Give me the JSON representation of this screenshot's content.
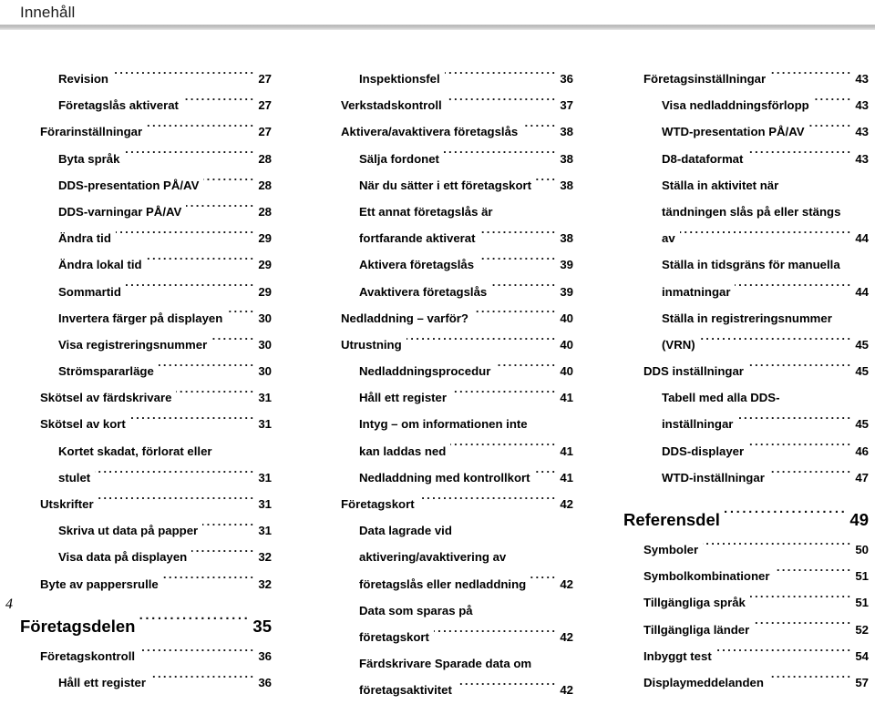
{
  "header": {
    "title": "Innehåll"
  },
  "footer": {
    "page_number": "4"
  },
  "columns": [
    {
      "name": "column-left",
      "entries": [
        {
          "level": 2,
          "label": "Revision",
          "page": "27"
        },
        {
          "level": 2,
          "label": "Företagslås aktiverat",
          "page": "27"
        },
        {
          "level": 1,
          "label": "Förarinställningar",
          "page": "27"
        },
        {
          "level": 2,
          "label": "Byta språk",
          "page": "28"
        },
        {
          "level": 2,
          "label": "DDS-presentation PÅ/AV",
          "page": "28"
        },
        {
          "level": 2,
          "label": "DDS-varningar PÅ/AV",
          "page": "28"
        },
        {
          "level": 2,
          "label": "Ändra tid",
          "page": "29"
        },
        {
          "level": 2,
          "label": "Ändra lokal tid",
          "page": "29"
        },
        {
          "level": 2,
          "label": "Sommartid",
          "page": "29"
        },
        {
          "level": 2,
          "label": "Invertera färger på displayen",
          "page": "30"
        },
        {
          "level": 2,
          "label": "Visa registreringsnummer",
          "page": "30"
        },
        {
          "level": 2,
          "label": "Strömspararläge",
          "page": "30"
        },
        {
          "level": 1,
          "label": "Skötsel av färdskrivare",
          "page": "31"
        },
        {
          "level": 1,
          "label": "Skötsel av kort",
          "page": "31"
        },
        {
          "level": 2,
          "label": "Kortet skadat, förlorat eller",
          "page": "",
          "wrap_top": true
        },
        {
          "level": 2,
          "label": "stulet",
          "page": "31"
        },
        {
          "level": 1,
          "label": "Utskrifter",
          "page": "31"
        },
        {
          "level": 2,
          "label": "Skriva ut data på papper",
          "page": "31"
        },
        {
          "level": 2,
          "label": "Visa data på displayen",
          "page": "32"
        },
        {
          "level": 1,
          "label": "Byte av pappersrulle",
          "page": "32"
        },
        {
          "level": 0,
          "label": "Företagsdelen",
          "page": "35",
          "gap_before": true
        },
        {
          "level": 1,
          "label": "Företagskontroll",
          "page": "36"
        },
        {
          "level": 2,
          "label": "Håll ett register",
          "page": "36"
        }
      ]
    },
    {
      "name": "column-middle",
      "entries": [
        {
          "level": 2,
          "label": "Inspektionsfel",
          "page": "36"
        },
        {
          "level": 1,
          "label": "Verkstadskontroll",
          "page": "37"
        },
        {
          "level": 1,
          "label": "Aktivera/avaktivera företagslås",
          "page": "38"
        },
        {
          "level": 2,
          "label": "Sälja fordonet",
          "page": "38"
        },
        {
          "level": 2,
          "label": "När du sätter i ett företagskort",
          "page": "38"
        },
        {
          "level": 2,
          "label": "Ett annat företagslås är",
          "page": "",
          "wrap_top": true
        },
        {
          "level": 2,
          "label": "fortfarande aktiverat",
          "page": "38"
        },
        {
          "level": 2,
          "label": "Aktivera företagslås",
          "page": "39"
        },
        {
          "level": 2,
          "label": "Avaktivera företagslås",
          "page": "39"
        },
        {
          "level": 1,
          "label": "Nedladdning – varför?",
          "page": "40"
        },
        {
          "level": 1,
          "label": "Utrustning",
          "page": "40"
        },
        {
          "level": 2,
          "label": "Nedladdningsprocedur",
          "page": "40"
        },
        {
          "level": 2,
          "label": "Håll ett register",
          "page": "41"
        },
        {
          "level": 2,
          "label": "Intyg – om informationen inte",
          "page": "",
          "wrap_top": true
        },
        {
          "level": 2,
          "label": "kan laddas ned",
          "page": "41"
        },
        {
          "level": 2,
          "label": "Nedladdning med kontrollkort",
          "page": "41"
        },
        {
          "level": 1,
          "label": "Företagskort",
          "page": "42"
        },
        {
          "level": 2,
          "label": "Data lagrade vid",
          "page": "",
          "wrap_top": true
        },
        {
          "level": 2,
          "label": "aktivering/avaktivering av",
          "page": "",
          "wrap_top": true
        },
        {
          "level": 2,
          "label": "företagslås eller nedladdning",
          "page": "42"
        },
        {
          "level": 2,
          "label": "Data som sparas på",
          "page": "",
          "wrap_top": true
        },
        {
          "level": 2,
          "label": "företagskort",
          "page": "42"
        },
        {
          "level": 2,
          "label": "Färdskrivare Sparade data om",
          "page": "",
          "wrap_top": true
        },
        {
          "level": 2,
          "label": "företagsaktivitet",
          "page": "42"
        }
      ]
    },
    {
      "name": "column-right",
      "entries": [
        {
          "level": 1,
          "label": "Företagsinställningar",
          "page": "43"
        },
        {
          "level": 2,
          "label": "Visa nedladdningsförlopp",
          "page": "43"
        },
        {
          "level": 2,
          "label": "WTD-presentation PÅ/AV",
          "page": "43"
        },
        {
          "level": 2,
          "label": "D8-dataformat",
          "page": "43"
        },
        {
          "level": 2,
          "label": "Ställa in aktivitet när",
          "page": "",
          "wrap_top": true
        },
        {
          "level": 2,
          "label": "tändningen slås på eller stängs",
          "page": "",
          "wrap_top": true
        },
        {
          "level": 2,
          "label": "av",
          "page": "44"
        },
        {
          "level": 2,
          "label": "Ställa in tidsgräns för manuella",
          "page": "",
          "wrap_top": true
        },
        {
          "level": 2,
          "label": "inmatningar",
          "page": "44"
        },
        {
          "level": 2,
          "label": "Ställa in registreringsnummer",
          "page": "",
          "wrap_top": true
        },
        {
          "level": 2,
          "label": "(VRN)",
          "page": "45"
        },
        {
          "level": 1,
          "label": "DDS inställningar",
          "page": "45"
        },
        {
          "level": 2,
          "label": "Tabell med alla DDS-",
          "page": "",
          "wrap_top": true
        },
        {
          "level": 2,
          "label": "inställningar",
          "page": "45"
        },
        {
          "level": 2,
          "label": "DDS-displayer",
          "page": "46"
        },
        {
          "level": 2,
          "label": "WTD-inställningar",
          "page": "47"
        },
        {
          "level": 0,
          "label": "Referensdel",
          "page": "49",
          "gap_before": true
        },
        {
          "level": 1,
          "label": "Symboler",
          "page": "50"
        },
        {
          "level": 1,
          "label": "Symbolkombinationer",
          "page": "51"
        },
        {
          "level": 1,
          "label": "Tillgängliga språk",
          "page": "51"
        },
        {
          "level": 1,
          "label": "Tillgängliga länder",
          "page": "52"
        },
        {
          "level": 1,
          "label": "Inbyggt test",
          "page": "54"
        },
        {
          "level": 1,
          "label": "Displaymeddelanden",
          "page": "57"
        }
      ]
    }
  ]
}
